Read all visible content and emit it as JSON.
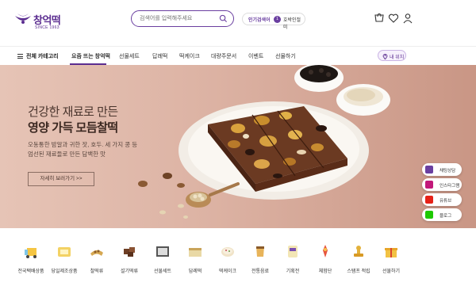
{
  "header": {
    "brand_name": "창억떡",
    "brand_since": "SINCE 1963",
    "search_placeholder": "검색어를 입력해주세요",
    "trending_label": "인기검색어",
    "trending_rank": "1",
    "trending_keyword": "호박인절미"
  },
  "nav": {
    "all_categories": "전체 카테고리",
    "items": [
      {
        "label": "요즘 뜨는 창억떡",
        "active": true
      },
      {
        "label": "선물세트"
      },
      {
        "label": "답례떡"
      },
      {
        "label": "떡케이크"
      },
      {
        "label": "대량주문서"
      },
      {
        "label": "이벤트"
      },
      {
        "label": "선물하기"
      }
    ],
    "location_label": "내 위치"
  },
  "hero": {
    "headline_1": "건강한 재료로 만든",
    "headline_2": "영양 가득 모듬찰떡",
    "description_1": "오동통한 밤알과 귀한 잣, 호두. 세 가지 콩 등",
    "description_2": "엄선된 재료들로 만든 담백한 맛",
    "cta_label": "자세히 보러가기 >>"
  },
  "floating": [
    {
      "label": "채팅상담",
      "icon": "chat-icon",
      "color": "#6a3fa0"
    },
    {
      "label": "인스타그램",
      "icon": "instagram-icon",
      "color": "#c2187a"
    },
    {
      "label": "유튜브",
      "icon": "youtube-icon",
      "color": "#e62117"
    },
    {
      "label": "블로그",
      "icon": "blog-icon",
      "color": "#1ec800"
    }
  ],
  "categories": [
    {
      "label": "전국택배상품",
      "icon": "delivery-icon"
    },
    {
      "label": "당일제조상품",
      "icon": "fresh-icon"
    },
    {
      "label": "찰떡류",
      "icon": "chalttuk-icon"
    },
    {
      "label": "설기떡류",
      "icon": "seolgi-icon"
    },
    {
      "label": "선물세트",
      "icon": "gift-set-icon"
    },
    {
      "label": "답례떡",
      "icon": "return-gift-icon"
    },
    {
      "label": "떡케이크",
      "icon": "cake-icon"
    },
    {
      "label": "전통음료",
      "icon": "drink-icon"
    },
    {
      "label": "기획전",
      "icon": "exhibition-icon"
    },
    {
      "label": "체험단",
      "icon": "experience-icon"
    },
    {
      "label": "스탬프 적립",
      "icon": "stamp-icon"
    },
    {
      "label": "선물하기",
      "icon": "present-icon"
    }
  ],
  "colors": {
    "brand_purple": "#5b2d90",
    "hero_bg": "#dcb2a3"
  }
}
